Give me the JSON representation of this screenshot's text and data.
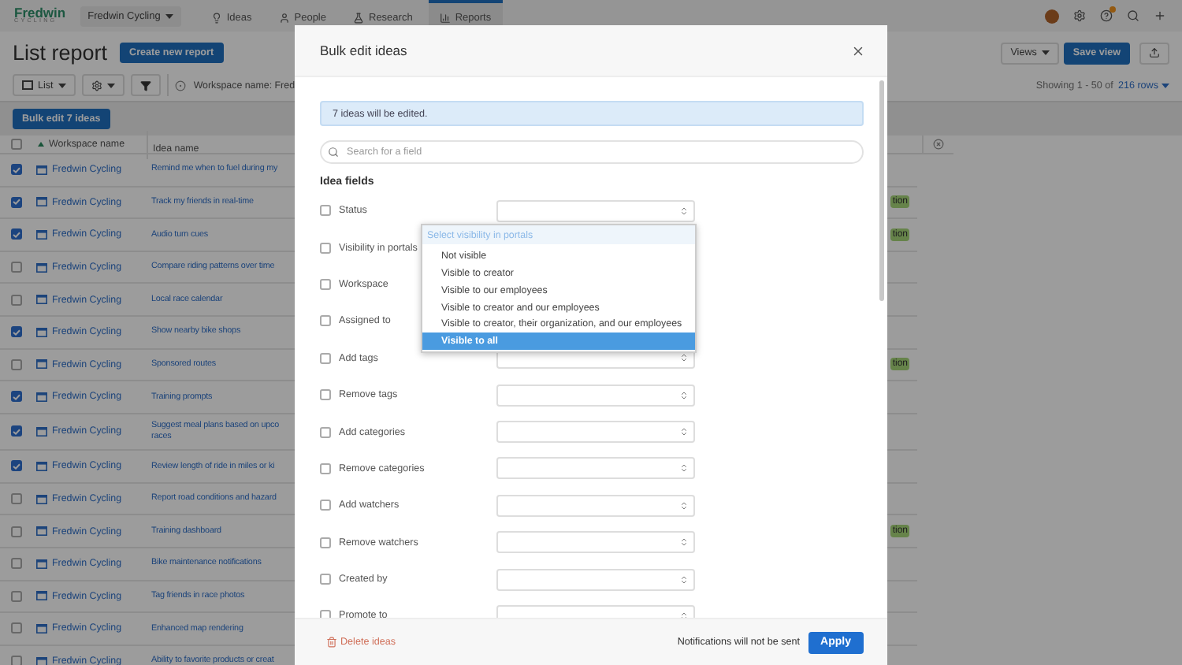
{
  "nav": {
    "logo_name": "Fredwin",
    "logo_tagline": "CYCLING",
    "workspace": "Fredwin Cycling",
    "notification_dot": true,
    "items": [
      {
        "kind": "ideas",
        "label": "Ideas",
        "selected": false
      },
      {
        "kind": "people",
        "label": "People",
        "selected": false
      },
      {
        "kind": "research",
        "label": "Research",
        "selected": false
      },
      {
        "kind": "reports",
        "label": "Reports",
        "selected": true
      }
    ]
  },
  "report": {
    "title": "List report",
    "create_button": "Create new report",
    "views_button": "Views",
    "save_button": "Save view",
    "list_button": "List",
    "filter_text": "Workspace name: Fred",
    "showing_text": "Showing 1 - 50 of",
    "rows_link": "216 rows",
    "bulk_button": "Bulk edit 7 ideas"
  },
  "table": {
    "header_checked": false,
    "columns": [
      "Workspace name",
      "Idea name"
    ],
    "rows": [
      {
        "checked": true,
        "workspace": "Fredwin Cycling",
        "idea": "Remind me when to fuel during my"
      },
      {
        "checked": true,
        "workspace": "Fredwin Cycling",
        "idea": "Track my friends in real-time",
        "tag": "tion"
      },
      {
        "checked": true,
        "workspace": "Fredwin Cycling",
        "idea": "Audio turn cues",
        "tag": "tion"
      },
      {
        "checked": false,
        "workspace": "Fredwin Cycling",
        "idea": "Compare riding patterns over time"
      },
      {
        "checked": false,
        "workspace": "Fredwin Cycling",
        "idea": "Local race calendar"
      },
      {
        "checked": true,
        "workspace": "Fredwin Cycling",
        "idea": "Show nearby bike shops"
      },
      {
        "checked": false,
        "workspace": "Fredwin Cycling",
        "idea": "Sponsored routes",
        "tag": "tion"
      },
      {
        "checked": true,
        "workspace": "Fredwin Cycling",
        "idea": "Training prompts"
      },
      {
        "checked": true,
        "workspace": "Fredwin Cycling",
        "idea": "Suggest meal plans based on upco\nraces"
      },
      {
        "checked": true,
        "workspace": "Fredwin Cycling",
        "idea": "Review length of ride in miles or ki"
      },
      {
        "checked": false,
        "workspace": "Fredwin Cycling",
        "idea": "Report road conditions and hazard"
      },
      {
        "checked": false,
        "workspace": "Fredwin Cycling",
        "idea": "Training dashboard",
        "tag": "tion"
      },
      {
        "checked": false,
        "workspace": "Fredwin Cycling",
        "idea": "Bike maintenance notifications"
      },
      {
        "checked": false,
        "workspace": "Fredwin Cycling",
        "idea": "Tag friends in race photos"
      },
      {
        "checked": false,
        "workspace": "Fredwin Cycling",
        "idea": "Enhanced map rendering"
      },
      {
        "checked": false,
        "workspace": "Fredwin Cycling",
        "idea": "Ability to favorite products or creat"
      }
    ]
  },
  "dialog": {
    "title": "Bulk edit ideas",
    "notice": "7 ideas will be edited.",
    "search_placeholder": "Search for a field",
    "section": "Idea fields",
    "fields": [
      {
        "label": "Status",
        "checked": false
      },
      {
        "label": "Visibility in portals",
        "checked": false,
        "dropdown": {
          "placeholder": "Select visibility in portals",
          "options": [
            {
              "label": "Not visible",
              "selected": false
            },
            {
              "label": "Visible to creator",
              "selected": false
            },
            {
              "label": "Visible to our employees",
              "selected": false
            },
            {
              "label": "Visible to creator and our employees",
              "selected": false
            },
            {
              "label": "Visible to creator, their organization, and our employees",
              "selected": false
            },
            {
              "label": "Visible to all",
              "selected": true
            }
          ]
        }
      },
      {
        "label": "Workspace",
        "checked": false
      },
      {
        "label": "Assigned to",
        "checked": false
      },
      {
        "label": "Add tags",
        "checked": false
      },
      {
        "label": "Remove tags",
        "checked": false
      },
      {
        "label": "Add categories",
        "checked": false
      },
      {
        "label": "Remove categories",
        "checked": false
      },
      {
        "label": "Add watchers",
        "checked": false
      },
      {
        "label": "Remove watchers",
        "checked": false
      },
      {
        "label": "Created by",
        "checked": false
      },
      {
        "label": "Promote to",
        "checked": false
      }
    ],
    "delete_button": "Delete ideas",
    "notification_note": "Notifications will not be sent",
    "apply_button": "Apply"
  }
}
